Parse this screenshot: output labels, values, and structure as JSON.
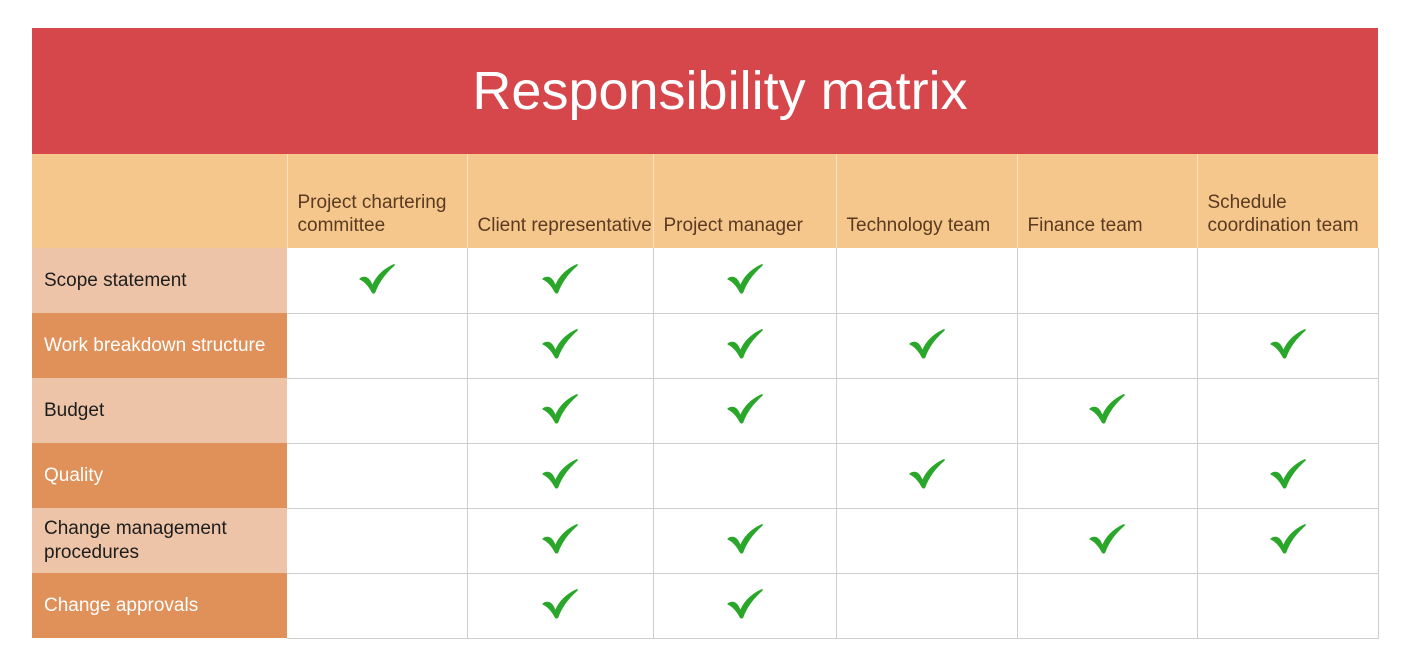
{
  "title": "Responsibility matrix",
  "colors": {
    "banner": "#d6474c",
    "banner_text": "#ffffff",
    "header_row": "#f5c78c",
    "header_text": "#5a3a20",
    "row_light": "#eec4a8",
    "row_light_text": "#1d1d1d",
    "row_dark": "#e09059",
    "row_dark_text": "#ffffff",
    "cell": "#ffffff",
    "gridline": "#cfcfcf",
    "check": "#2aa72a"
  },
  "table": {
    "corner_label": "",
    "columns": [
      "Project chartering committee",
      "Client representative",
      "Project manager",
      "Technology team",
      "Finance team",
      "Schedule coordination team"
    ],
    "rows": [
      {
        "label": "Scope statement",
        "shade": "light",
        "marks": [
          true,
          true,
          true,
          false,
          false,
          false
        ]
      },
      {
        "label": "Work breakdown structure",
        "shade": "dark",
        "marks": [
          false,
          true,
          true,
          true,
          false,
          true
        ]
      },
      {
        "label": "Budget",
        "shade": "light",
        "marks": [
          false,
          true,
          true,
          false,
          true,
          false
        ]
      },
      {
        "label": "Quality",
        "shade": "dark",
        "marks": [
          false,
          true,
          false,
          true,
          false,
          true
        ]
      },
      {
        "label": "Change management procedures",
        "shade": "light",
        "marks": [
          false,
          true,
          true,
          false,
          true,
          true
        ]
      },
      {
        "label": "Change approvals",
        "shade": "dark",
        "marks": [
          false,
          true,
          true,
          false,
          false,
          false
        ]
      }
    ],
    "mark_icon": "check-icon"
  }
}
